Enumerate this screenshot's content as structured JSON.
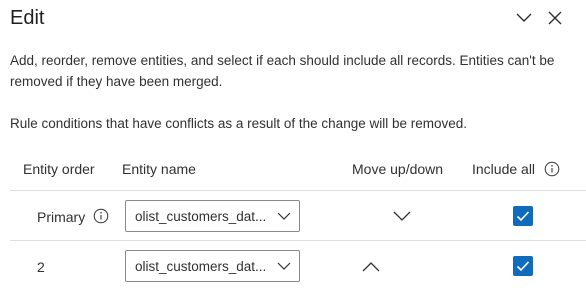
{
  "panel": {
    "title": "Edit",
    "description": "Add, reorder, remove entities, and select if each should include all records. Entities can't be removed if they have been merged.",
    "warning": "Rule conditions that have conflicts as a result of the change will be removed."
  },
  "table": {
    "headers": {
      "order": "Entity order",
      "name": "Entity name",
      "move": "Move up/down",
      "include": "Include all"
    },
    "rows": [
      {
        "order": "Primary",
        "entity": "olist_customers_dat...",
        "move": "down",
        "include_all": true
      },
      {
        "order": "2",
        "entity": "olist_customers_dat...",
        "move": "up",
        "include_all": true
      }
    ]
  },
  "colors": {
    "accent": "#0f6cbd",
    "text": "#323130",
    "border": "#8a8886"
  },
  "icons": [
    "chevron-down-icon",
    "close-icon",
    "info-icon",
    "checkmark-icon",
    "chevron-up-icon"
  ]
}
